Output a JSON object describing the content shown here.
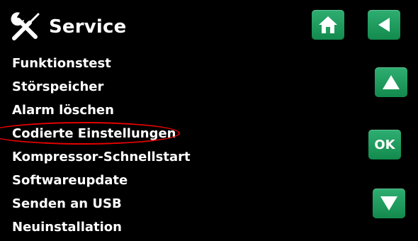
{
  "header": {
    "icon": "tools-icon",
    "title": "Service"
  },
  "menu": {
    "items": [
      {
        "label": "Funktionstest"
      },
      {
        "label": "Störspeicher"
      },
      {
        "label": "Alarm löschen"
      },
      {
        "label": "Codierte Einstellungen",
        "highlighted": true
      },
      {
        "label": "Kompressor-Schnellstart"
      },
      {
        "label": "Softwareupdate"
      },
      {
        "label": "Senden an USB"
      },
      {
        "label": "Neuinstallation"
      }
    ]
  },
  "buttons": {
    "home_icon": "home-icon",
    "back_icon": "back-arrow-icon",
    "up_icon": "arrow-up-icon",
    "ok_label": "OK",
    "down_icon": "arrow-down-icon"
  },
  "colors": {
    "background": "#000000",
    "text": "#ffffff",
    "button": "#1e9a5c",
    "highlight": "#e60000"
  }
}
